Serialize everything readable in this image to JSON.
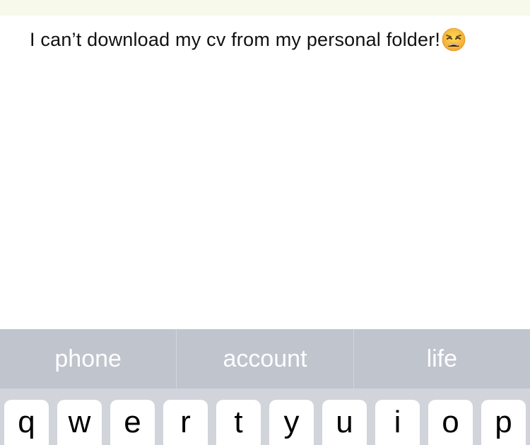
{
  "message": {
    "text": "I can’t download my cv from my personal folder!",
    "emoji": "weary-face-icon"
  },
  "suggestions": [
    "phone",
    "account",
    "life"
  ],
  "keyboard": {
    "row1": [
      "q",
      "w",
      "e",
      "r",
      "t",
      "y",
      "u",
      "i",
      "o",
      "p"
    ]
  },
  "colors": {
    "top_strip": "#f7f9ea",
    "suggestion_bar": "#bfc4cd",
    "keyboard_bg": "#d1d4da",
    "emoji_face": "#f6c343"
  }
}
